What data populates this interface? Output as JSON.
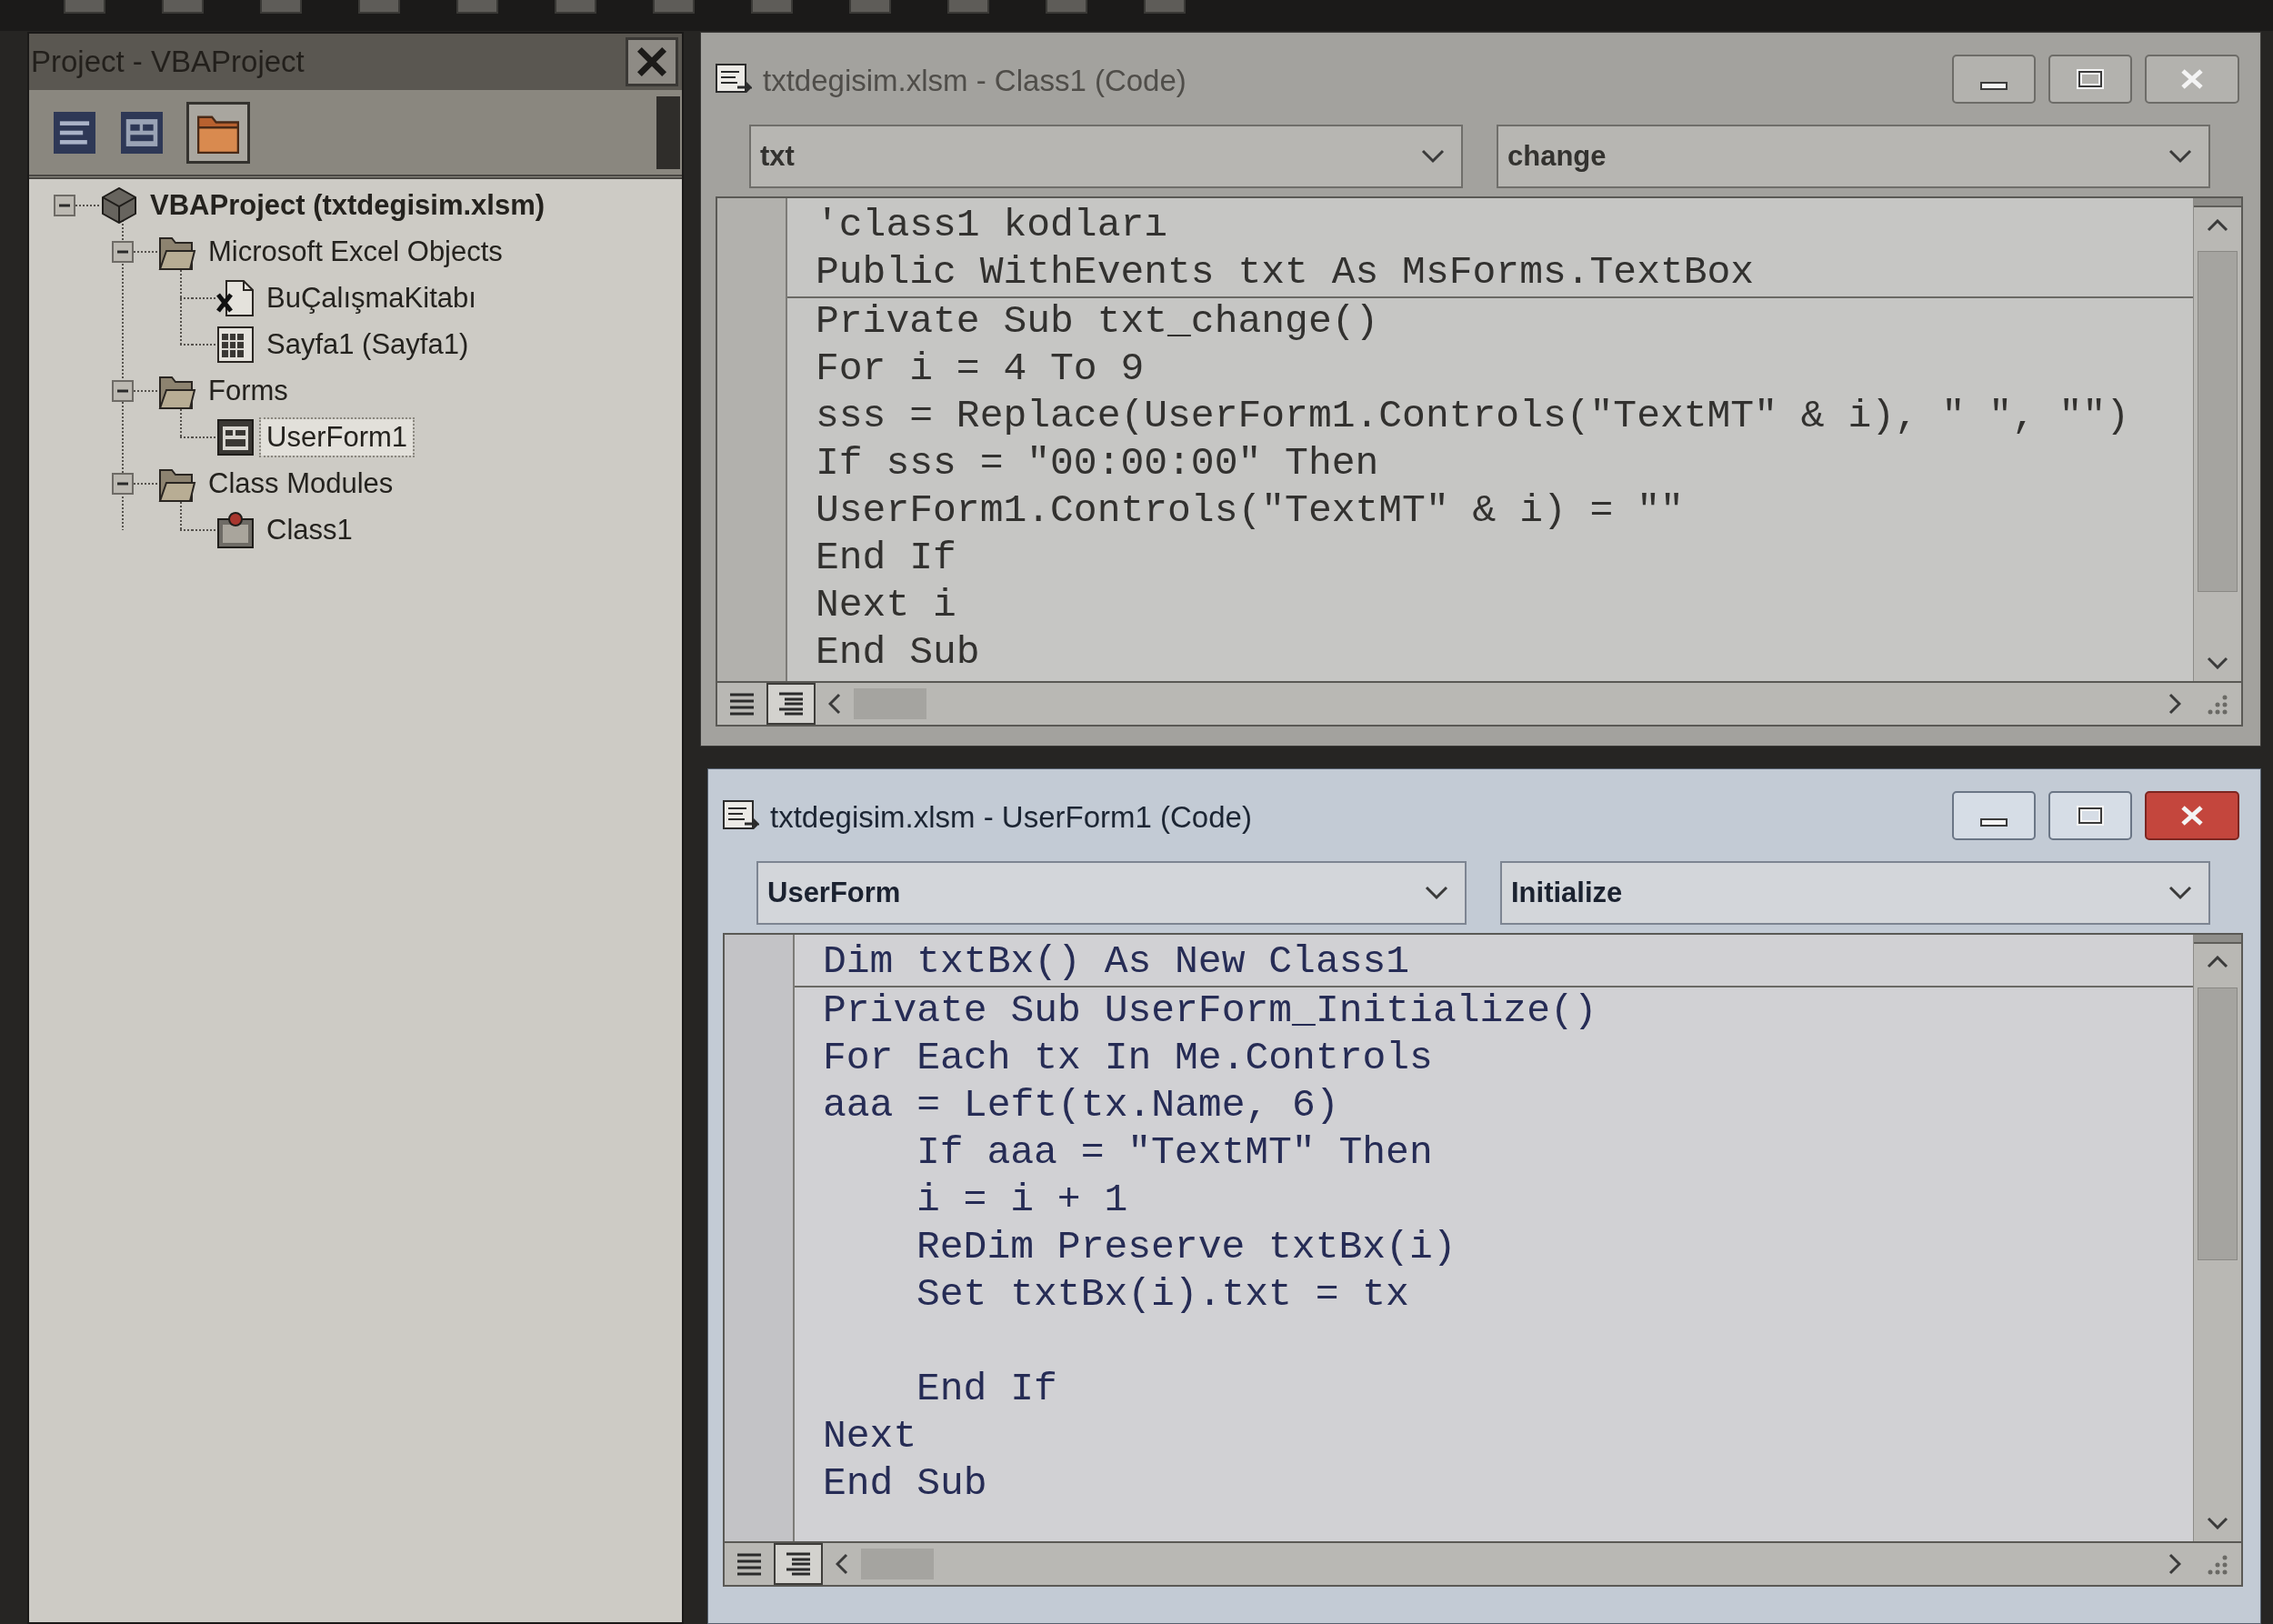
{
  "project_explorer": {
    "title": "Project - VBAProject",
    "toolbar": [
      {
        "kind": "view_code",
        "pressed": false
      },
      {
        "kind": "view_object",
        "pressed": false
      },
      {
        "kind": "toggle_folders",
        "pressed": true
      }
    ],
    "tree": [
      {
        "label": "VBAProject (txtdegisim.xlsm)",
        "kind": "project",
        "expanded": true,
        "selected": false,
        "children": [
          {
            "label": "Microsoft Excel Objects",
            "kind": "folder",
            "expanded": true,
            "selected": false,
            "children": [
              {
                "label": "BuÇalışmaKitabı",
                "kind": "workbook",
                "selected": false
              },
              {
                "label": "Sayfa1 (Sayfa1)",
                "kind": "sheet",
                "selected": false
              }
            ]
          },
          {
            "label": "Forms",
            "kind": "folder",
            "expanded": true,
            "selected": false,
            "children": [
              {
                "label": "UserForm1",
                "kind": "form",
                "selected": true
              }
            ]
          },
          {
            "label": "Class Modules",
            "kind": "folder",
            "expanded": true,
            "selected": false,
            "children": [
              {
                "label": "Class1",
                "kind": "class",
                "selected": false
              }
            ]
          }
        ]
      }
    ]
  },
  "code_windows": [
    {
      "title": "txtdegisim.xlsm - Class1 (Code)",
      "active": false,
      "object": "txt",
      "procedure": "change",
      "declarations": [
        {
          "kind": "code",
          "text": "'class1 kodları"
        },
        {
          "kind": "code",
          "text": "Public WithEvents txt As MsForms.TextBox"
        }
      ],
      "procedures": [
        {
          "kind": "code",
          "text": "Private Sub txt_change()"
        },
        {
          "kind": "code",
          "text": "For i = 4 To 9"
        },
        {
          "kind": "code",
          "text": "sss = Replace(UserForm1.Controls(\"TextMT\" & i), \" \", \"\")"
        },
        {
          "kind": "code",
          "text": "If sss = \"00:00:00\" Then"
        },
        {
          "kind": "code",
          "text": "UserForm1.Controls(\"TextMT\" & i) = \"\""
        },
        {
          "kind": "code",
          "text": "End If"
        },
        {
          "kind": "code",
          "text": "Next i"
        },
        {
          "kind": "code",
          "text": "End Sub"
        }
      ],
      "view_buttons": [
        {
          "kind": "procedure_view",
          "pressed": false
        },
        {
          "kind": "full_module_view",
          "pressed": true
        }
      ]
    },
    {
      "title": "txtdegisim.xlsm - UserForm1 (Code)",
      "active": true,
      "object": "UserForm",
      "procedure": "Initialize",
      "declarations": [
        {
          "kind": "code",
          "text": "Dim txtBx() As New Class1"
        }
      ],
      "procedures": [
        {
          "kind": "code",
          "text": "Private Sub UserForm_Initialize()"
        },
        {
          "kind": "code",
          "text": "For Each tx In Me.Controls"
        },
        {
          "kind": "code",
          "text": "aaa = Left(tx.Name, 6)"
        },
        {
          "kind": "block",
          "children": [
            {
              "kind": "code",
              "text": "If aaa = \"TextMT\" Then"
            },
            {
              "kind": "code",
              "text": "i = i + 1"
            },
            {
              "kind": "code",
              "text": "ReDim Preserve txtBx(i)"
            },
            {
              "kind": "code",
              "text": "Set txtBx(i).txt = tx"
            },
            {
              "kind": "blank"
            },
            {
              "kind": "code",
              "text": "End If"
            }
          ]
        },
        {
          "kind": "code",
          "text": "Next"
        },
        {
          "kind": "code",
          "text": "End Sub"
        }
      ],
      "view_buttons": [
        {
          "kind": "procedure_view",
          "pressed": false
        },
        {
          "kind": "full_module_view",
          "pressed": true
        }
      ]
    }
  ]
}
